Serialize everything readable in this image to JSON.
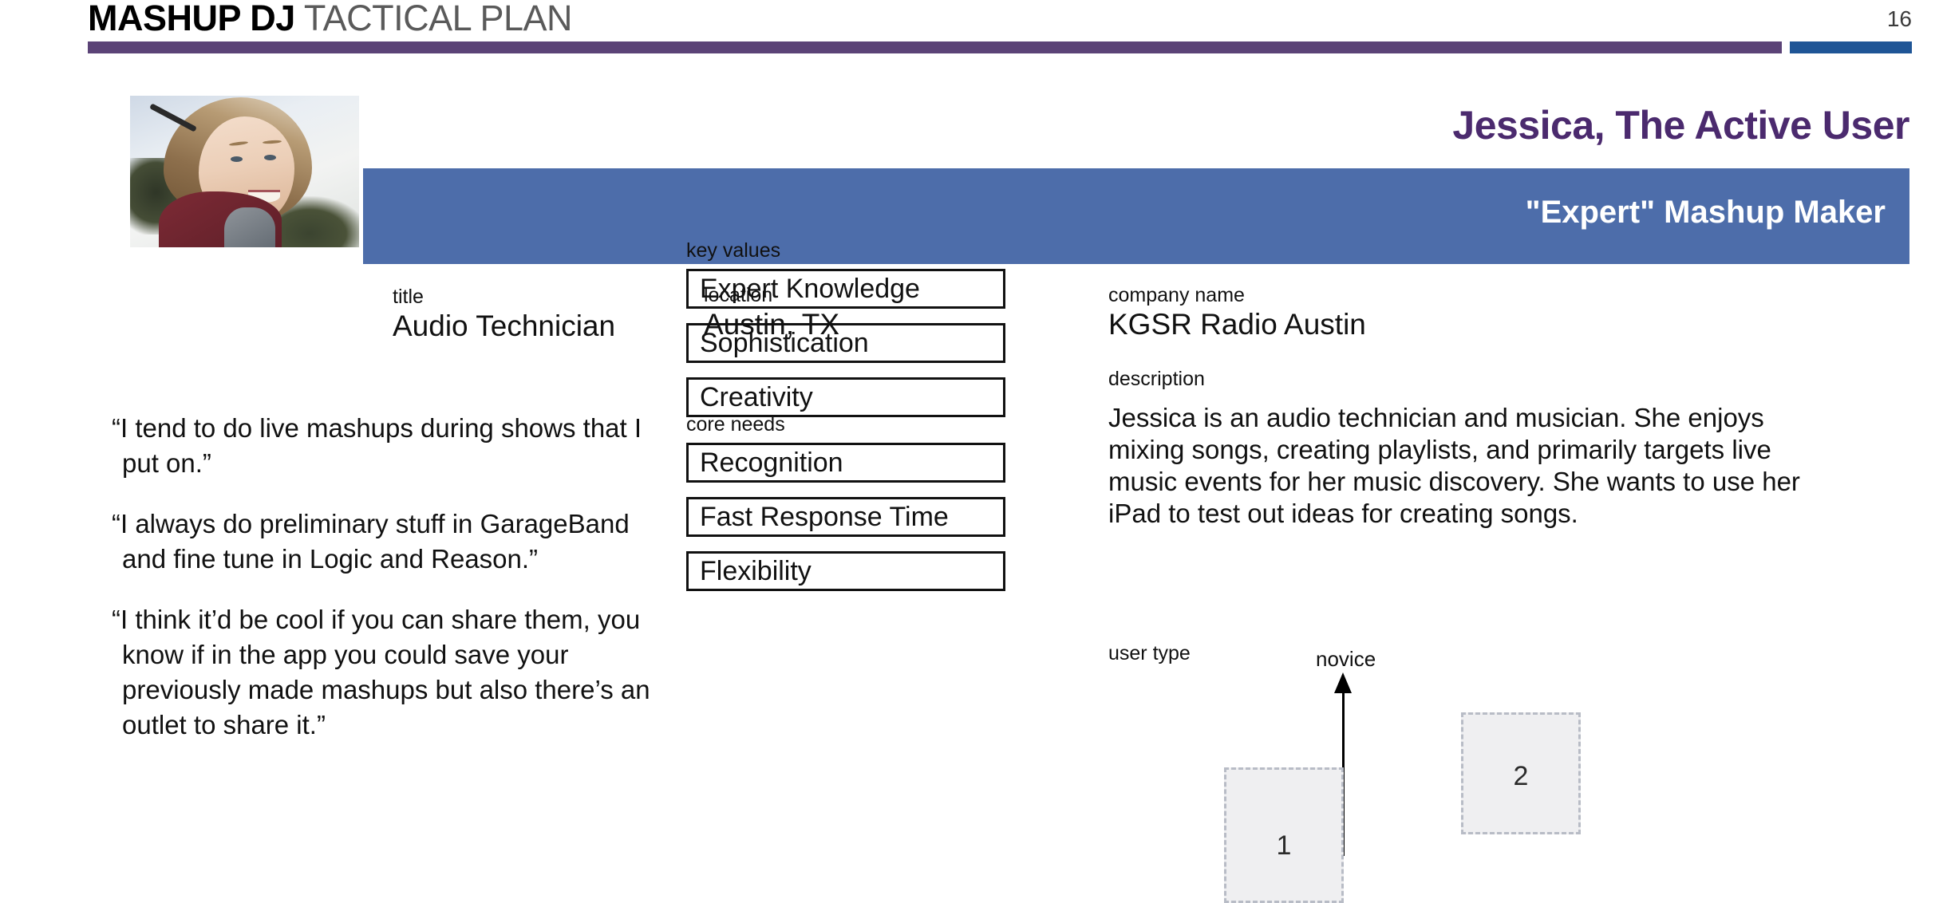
{
  "header": {
    "brand": "MASHUP DJ",
    "subtitle": " TACTICAL PLAN",
    "page_number": "16",
    "rule_purple_color": "#5b4377",
    "rule_blue_color": "#1f5596"
  },
  "persona": {
    "name": "Jessica, The Active User",
    "name_color": "#4b2a6e",
    "role_banner": "\"Expert\" Mashup Maker",
    "role_banner_color": "#4d6daa",
    "photo_alt": "portrait-of-smiling-young-woman-outdoors",
    "fields": {
      "title_label": "title",
      "title_value": "Audio Technician",
      "location_label": "location",
      "location_value": "Austin, TX",
      "company_label": "company name",
      "company_value": "KGSR Radio Austin",
      "description_label": "description",
      "description_value": "Jessica is an audio technician and musician. She enjoys mixing songs, creating playlists, and primarily targets live music events for her music discovery. She wants to use her iPad to test out ideas for creating songs."
    },
    "quotes": [
      "“I tend to do live mashups during shows that I put on.”",
      "“I always do preliminary stuff in GarageBand and fine tune in Logic and Reason.”",
      "“I think it’d be cool if you can share them, you know if in the app you could save your previously made mashups but also there’s an outlet to share it.”"
    ],
    "key_values": {
      "label": "key values",
      "items": [
        "Expert Knowledge",
        "Sophistication",
        "Creativity"
      ]
    },
    "core_needs": {
      "label": "core needs",
      "items": [
        "Recognition",
        "Fast Response Time",
        "Flexibility"
      ]
    }
  },
  "chart_data": {
    "type": "bar",
    "title": "user type",
    "axis_top_label": "novice",
    "axis_bottom_left_label": "",
    "axis_bottom_right_label": "",
    "categories": [
      "1",
      "2"
    ],
    "values": [
      1,
      2
    ],
    "segment_labels": [
      "1",
      "2"
    ],
    "grid": false,
    "legend": "none"
  }
}
